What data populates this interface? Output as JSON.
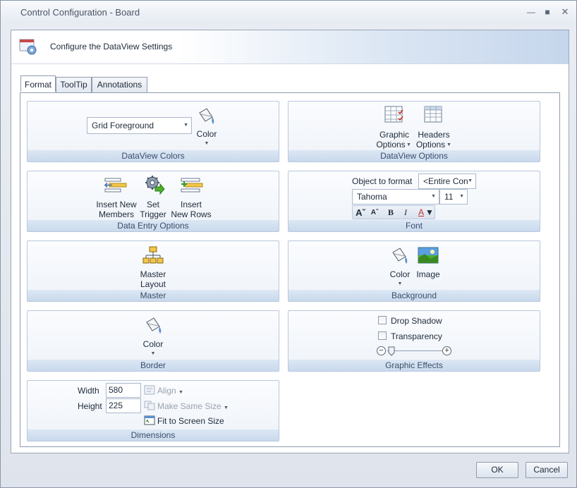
{
  "window": {
    "title": "Control Configuration - Board"
  },
  "banner": {
    "text": "Configure the DataView Settings"
  },
  "tabs": [
    {
      "label": "Format"
    },
    {
      "label": "ToolTip"
    },
    {
      "label": "Annotations"
    }
  ],
  "groups": {
    "dataview_colors": {
      "caption": "DataView Colors",
      "dropdown_value": "Grid Foreground",
      "color_label": "Color"
    },
    "dataview_options": {
      "caption": "DataView Options",
      "graphic_line1": "Graphic",
      "graphic_line2": "Options",
      "headers_line1": "Headers",
      "headers_line2": "Options"
    },
    "data_entry": {
      "caption": "Data Entry Options",
      "insert_members_line1": "Insert New",
      "insert_members_line2": "Members",
      "set_trigger_line1": "Set",
      "set_trigger_line2": "Trigger",
      "insert_rows_line1": "Insert",
      "insert_rows_line2": "New Rows"
    },
    "font": {
      "caption": "Font",
      "object_label": "Object to format",
      "object_value": "<Entire Con",
      "font_name": "Tahoma",
      "font_size": "11"
    },
    "master": {
      "caption": "Master",
      "layout_line1": "Master",
      "layout_line2": "Layout"
    },
    "background": {
      "caption": "Background",
      "color_label": "Color",
      "image_label": "Image"
    },
    "border": {
      "caption": "Border",
      "color_label": "Color"
    },
    "graphic_effects": {
      "caption": "Graphic Effects",
      "drop_shadow": "Drop Shadow",
      "transparency": "Transparency",
      "transparency_level": 0.08
    },
    "dimensions": {
      "caption": "Dimensions",
      "width_label": "Width",
      "width_value": "580",
      "height_label": "Height",
      "height_value": "225",
      "align_label": "Align",
      "same_size_label": "Make Same Size",
      "fit_label": "Fit to Screen Size"
    }
  },
  "buttons": {
    "ok": "OK",
    "cancel": "Cancel"
  },
  "colors": {
    "caption_bg": "#c9d9ec",
    "accent": "#3a4d6b"
  }
}
